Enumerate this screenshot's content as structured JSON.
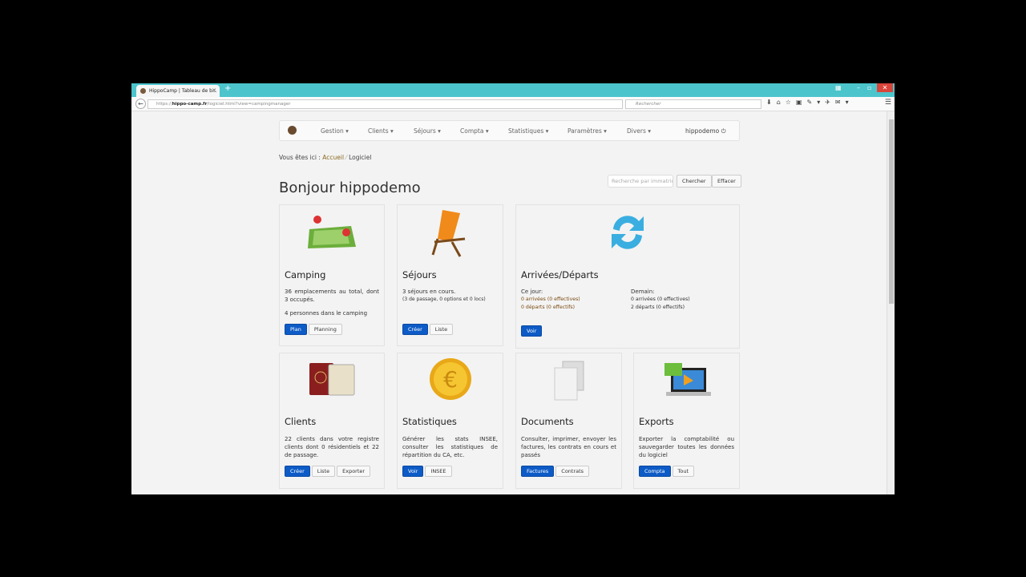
{
  "browser": {
    "tab_title": "HippoCamp | Tableau de b...",
    "url_prefix": "https://",
    "url_host": "hippo-camp.fr",
    "url_path": "/logiciel.html?view=campingmanager",
    "search_placeholder": "Rechercher"
  },
  "nav": {
    "items": [
      "Gestion ▾",
      "Clients ▾",
      "Séjours ▾",
      "Compta ▾",
      "Statistiques ▾",
      "Paramètres ▾",
      "Divers ▾"
    ],
    "user": "hippodemo ⏻"
  },
  "breadcrumb": {
    "prefix": "Vous êtes ici :",
    "home": "Accueil",
    "sep": "⁄",
    "current": "Logiciel"
  },
  "page": {
    "title": "Bonjour hippodemo",
    "search_placeholder": "Recherche par immatric",
    "search_btn": "Chercher",
    "clear_btn": "Effacer"
  },
  "cards": {
    "camping": {
      "title": "Camping",
      "line1": "36 emplacements au total, dont 3 occupés.",
      "line2": "4 personnes dans le camping",
      "btn1": "Plan",
      "btn2": "Planning"
    },
    "sejours": {
      "title": "Séjours",
      "line1": "3 séjours en cours.",
      "line2": "(3 de passage, 0 options et 0 locs)",
      "btn1": "Créer",
      "btn2": "Liste"
    },
    "arrivees": {
      "title": "Arrivées/Départs",
      "today_label": "Ce jour:",
      "today_arr": "0 arrivées (0 effectives)",
      "today_dep": "0 départs (0 effectifs)",
      "tomorrow_label": "Demain:",
      "tomorrow_arr": "0 arrivées (0 effectives)",
      "tomorrow_dep": "2 départs (0 effectifs)",
      "btn1": "Voir"
    },
    "clients": {
      "title": "Clients",
      "text": "22 clients dans votre registre clients dont 0 résidentiels et 22 de passage.",
      "btn1": "Créer",
      "btn2": "Liste",
      "btn3": "Exporter"
    },
    "stats": {
      "title": "Statistiques",
      "text": "Générer les stats INSEE, consulter les statistiques de répartition du CA, etc.",
      "btn1": "Voir",
      "btn2": "INSEE"
    },
    "documents": {
      "title": "Documents",
      "text": "Consulter, imprimer, envoyer les factures, les contrats en cours et passés",
      "btn1": "Factures",
      "btn2": "Contrats"
    },
    "exports": {
      "title": "Exports",
      "text": "Exporter la comptabilité ou sauvegarder toutes les données du logiciel",
      "btn1": "Compta",
      "btn2": "Tout"
    }
  }
}
